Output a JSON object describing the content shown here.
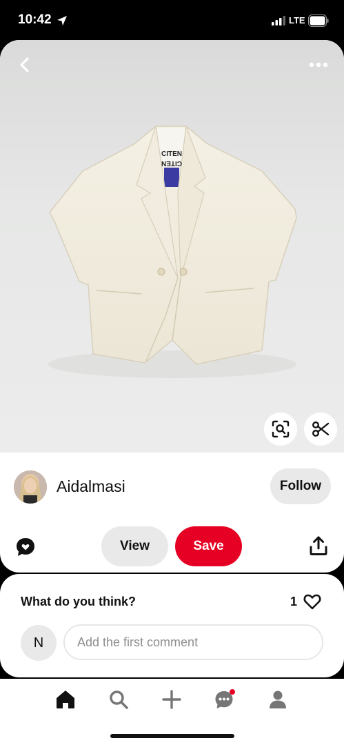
{
  "status_bar": {
    "time": "10:42",
    "network": "LTE"
  },
  "pin": {
    "image_alt": "cream short-sleeve blazer",
    "label_text_1": "CITEN",
    "label_text_2": "CITEN"
  },
  "creator": {
    "name": "Aidalmasi",
    "follow_label": "Follow"
  },
  "actions": {
    "view_label": "View",
    "save_label": "Save"
  },
  "comments": {
    "title": "What do you think?",
    "like_count": "1",
    "user_initial": "N",
    "input_placeholder": "Add the first comment"
  },
  "nav": {
    "items": [
      "home-icon",
      "search-icon",
      "plus-icon",
      "messages-icon",
      "profile-icon"
    ],
    "messages_badge_color": "#e60023"
  },
  "colors": {
    "accent": "#e60023",
    "pill_bg": "#e9e9e9"
  }
}
